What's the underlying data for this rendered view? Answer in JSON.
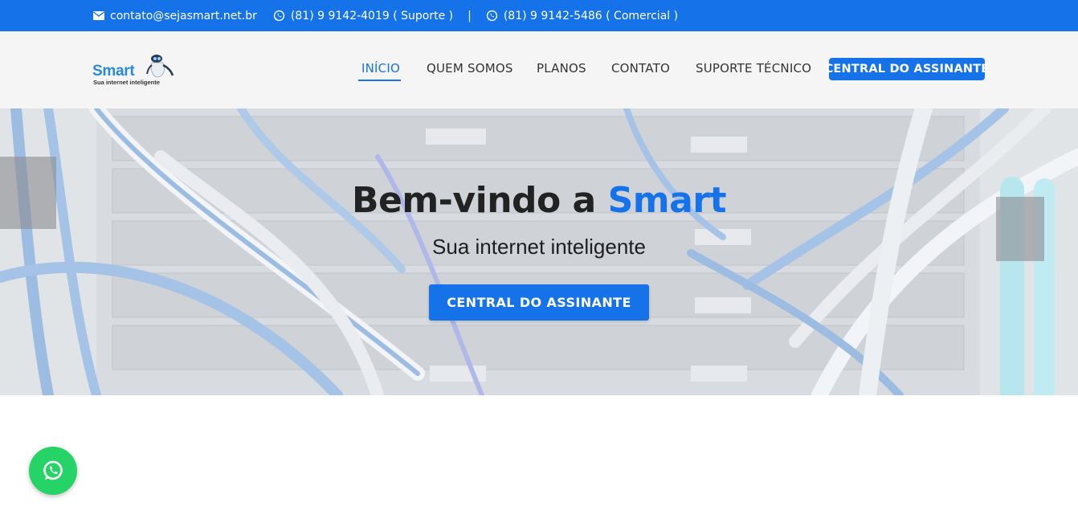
{
  "topbar": {
    "email": "contato@sejasmart.net.br",
    "phone_support": "(81) 9 9142-4019 ( Suporte )",
    "separator": "|",
    "phone_commercial": "(81) 9 9142-5486 ( Comercial )",
    "email_icon": "envelope-icon",
    "phone_icon": "whatsapp-icon"
  },
  "brand": {
    "name": "Smart",
    "tagline": "Sua internet inteligente"
  },
  "nav": {
    "items": [
      {
        "label": "INÍCIO",
        "active": true
      },
      {
        "label": "QUEM SOMOS",
        "active": false
      },
      {
        "label": "PLANOS",
        "active": false
      },
      {
        "label": "CONTATO",
        "active": false
      },
      {
        "label": "SUPORTE TÉCNICO",
        "active": false
      }
    ],
    "cta": "CENTRAL DO ASSINANTE"
  },
  "hero": {
    "title_prefix": "Bem-vindo a ",
    "title_accent": "Smart",
    "subtitle": "Sua internet inteligente",
    "button": "CENTRAL DO ASSINANTE"
  },
  "float": {
    "icon": "whatsapp-icon"
  },
  "colors": {
    "accent": "#1572e8",
    "whatsapp": "#25d366",
    "header_bg": "#f5f5f5"
  }
}
